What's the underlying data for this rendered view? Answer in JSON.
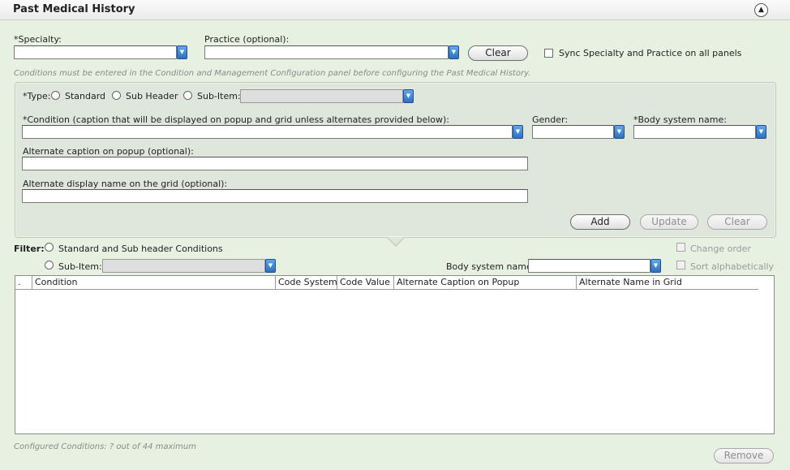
{
  "header": {
    "title": "Past Medical History"
  },
  "top": {
    "specialty_label": "*Specialty:",
    "practice_label": "Practice (optional):",
    "clear_label": "Clear",
    "sync_label": "Sync Specialty and Practice on all panels",
    "note": "Conditions must be entered in the Condition and Management Configuration panel before configuring the Past Medical History."
  },
  "form": {
    "type_label": "*Type:",
    "type_options": [
      "Standard",
      "Sub Header",
      "Sub-Item:"
    ],
    "condition_label": "*Condition (caption that will be displayed on popup and grid unless alternates provided below):",
    "gender_label": "Gender:",
    "body_system_label": "*Body system name:",
    "alt_caption_label": "Alternate caption on popup (optional):",
    "alt_display_label": "Alternate display name on the grid (optional):",
    "add_label": "Add",
    "update_label": "Update",
    "clear_label": "Clear"
  },
  "filter": {
    "label": "Filter:",
    "standard_option": "Standard and Sub header Conditions",
    "subitem_option": "Sub-Item:",
    "body_system_label": "Body system name:",
    "change_order_label": "Change order",
    "sort_label": "Sort alphabetically"
  },
  "grid": {
    "columns": [
      ".",
      "Condition",
      "Code System",
      "Code Value",
      "Alternate Caption on Popup",
      "Alternate Name in Grid"
    ]
  },
  "footer": {
    "configured": "Configured Conditions: ? out of 44 maximum",
    "remove_label": "Remove"
  }
}
